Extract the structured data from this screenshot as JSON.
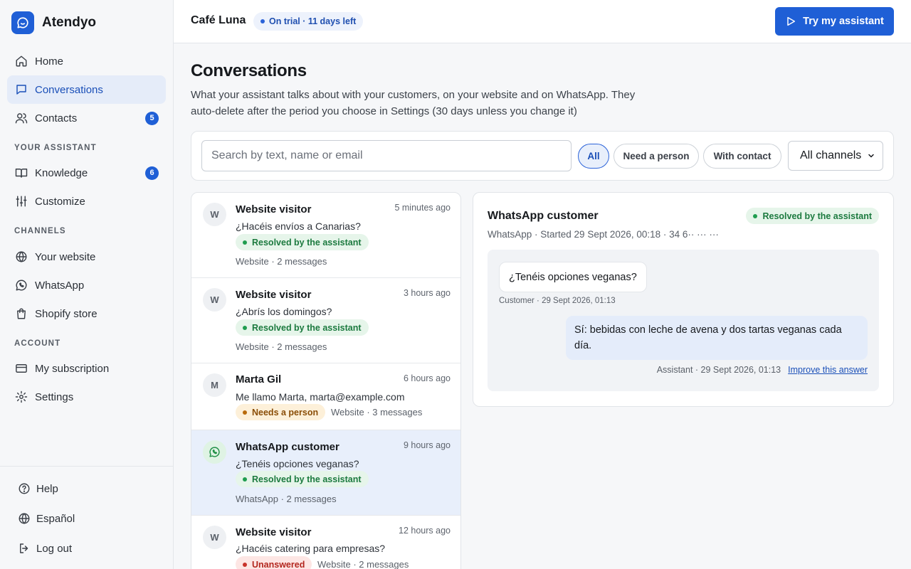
{
  "brand": {
    "name": "Atendyo"
  },
  "sidebar": {
    "items": [
      {
        "label": "Home",
        "icon": "home-icon"
      },
      {
        "label": "Conversations",
        "icon": "chat-icon",
        "active": true
      },
      {
        "label": "Contacts",
        "icon": "users-icon",
        "count": "5"
      }
    ],
    "sections": {
      "assistant": {
        "title": "YOUR ASSISTANT",
        "items": [
          {
            "label": "Knowledge",
            "icon": "book-icon",
            "count": "6"
          },
          {
            "label": "Customize",
            "icon": "sliders-icon"
          }
        ]
      },
      "channels": {
        "title": "CHANNELS",
        "items": [
          {
            "label": "Your website",
            "icon": "globe-icon"
          },
          {
            "label": "WhatsApp",
            "icon": "whatsapp-icon"
          },
          {
            "label": "Shopify store",
            "icon": "shopping-bag-icon"
          }
        ]
      },
      "account": {
        "title": "ACCOUNT",
        "items": [
          {
            "label": "My subscription",
            "icon": "credit-card-icon"
          },
          {
            "label": "Settings",
            "icon": "gear-icon"
          }
        ]
      }
    },
    "footer": [
      {
        "label": "Help",
        "icon": "help-circle-icon"
      },
      {
        "label": "Español",
        "icon": "globe-icon"
      },
      {
        "label": "Log out",
        "icon": "logout-icon"
      }
    ]
  },
  "topbar": {
    "business": "Café Luna",
    "trial": "On trial · 11 days left",
    "try_button": "Try my assistant"
  },
  "page": {
    "title": "Conversations",
    "subtitle": "What your assistant talks about with your customers, on your website and on WhatsApp. They auto-delete after the period you choose in Settings (30 days unless you change it)"
  },
  "filters": {
    "search_placeholder": "Search by text, name or email",
    "chips": [
      "All",
      "Need a person",
      "With contact"
    ],
    "active_chip": "All",
    "channel_select": "All channels"
  },
  "conversations": [
    {
      "avatar": "W",
      "name": "Website visitor",
      "time": "5 minutes ago",
      "message": "¿Hacéis envíos a Canarias?",
      "status": "Resolved by the assistant",
      "status_color": "green",
      "meta": "Website · 2 messages"
    },
    {
      "avatar": "W",
      "name": "Website visitor",
      "time": "3 hours ago",
      "message": "¿Abrís los domingos?",
      "status": "Resolved by the assistant",
      "status_color": "green",
      "meta": "Website · 2 messages"
    },
    {
      "avatar": "M",
      "name": "Marta Gil",
      "time": "6 hours ago",
      "message": "Me llamo Marta, marta@example.com",
      "status": "Needs a person",
      "status_color": "orange",
      "meta": "Website · 3 messages"
    },
    {
      "avatar": "whatsapp-icon",
      "name": "WhatsApp customer",
      "time": "9 hours ago",
      "message": "¿Tenéis opciones veganas?",
      "status": "Resolved by the assistant",
      "status_color": "green",
      "meta": "WhatsApp · 2 messages",
      "selected": true
    },
    {
      "avatar": "W",
      "name": "Website visitor",
      "time": "12 hours ago",
      "message": "¿Hacéis catering para empresas?",
      "status": "Unanswered",
      "status_color": "red",
      "meta": "Website · 2 messages"
    }
  ],
  "detail": {
    "title": "WhatsApp customer",
    "status": "Resolved by the assistant",
    "meta": "WhatsApp · Started 29 Sept 2026, 00:18 · 34 6·· ··· ···",
    "messages": [
      {
        "role": "customer",
        "text": "¿Tenéis opciones veganas?",
        "meta": "Customer · 29 Sept 2026, 01:13"
      },
      {
        "role": "assistant",
        "text": "Sí: bebidas con leche de avena y dos tartas veganas cada día.",
        "meta": "Assistant · 29 Sept 2026, 01:13",
        "action": "Improve this answer"
      }
    ]
  },
  "colors": {
    "accent": "#1f5fd6",
    "resolved": "#1f9d4f",
    "needs_person": "#b86a0a",
    "unanswered": "#c8322a"
  }
}
